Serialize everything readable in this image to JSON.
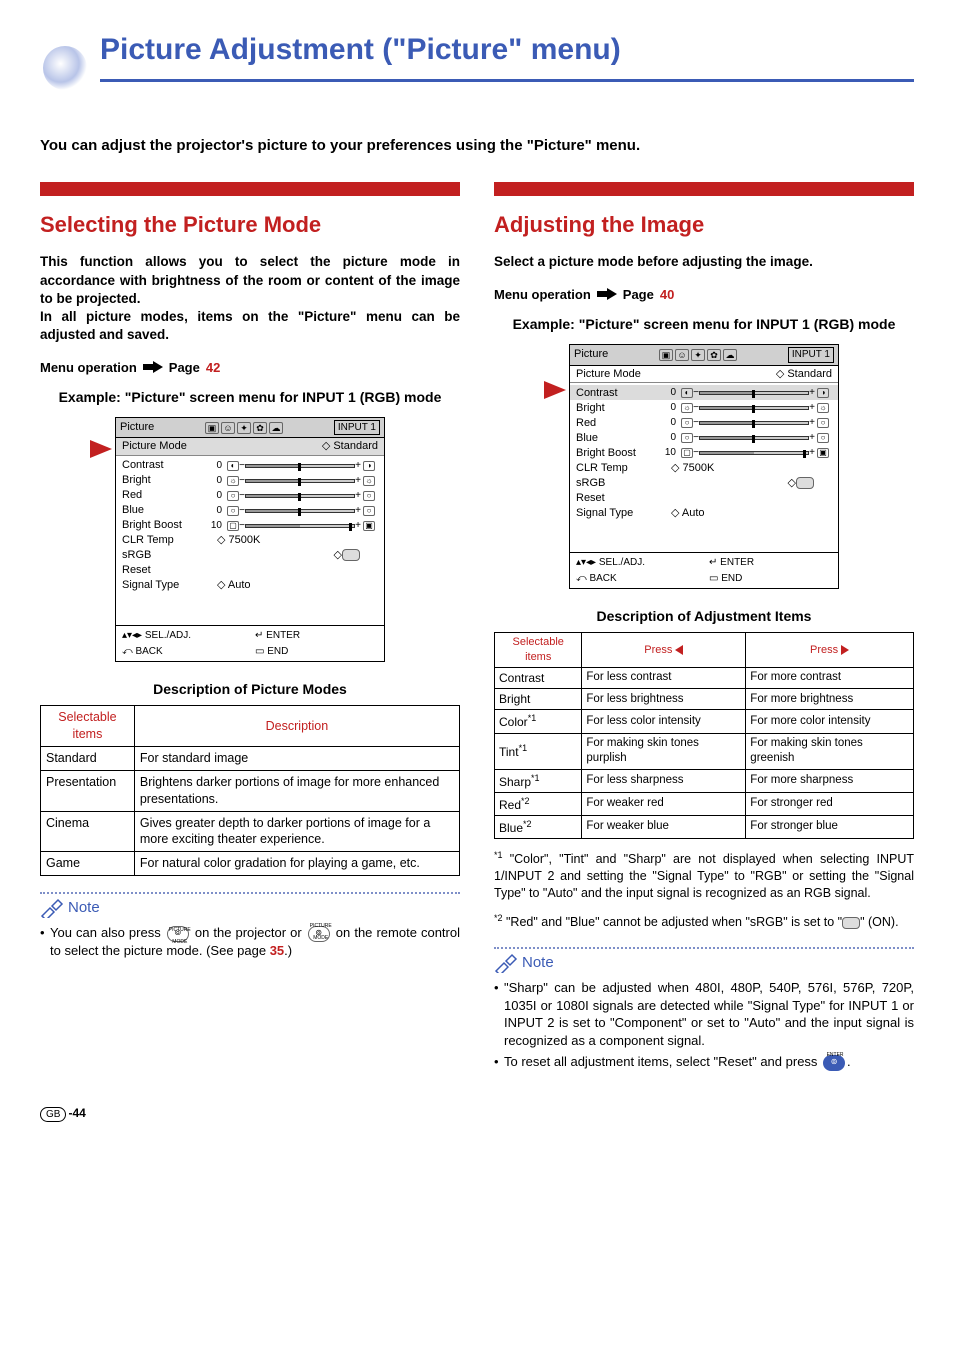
{
  "pageTitle": "Picture Adjustment (\"Picture\" menu)",
  "intro": "You can adjust the projector's picture to your preferences using the \"Picture\" menu.",
  "left": {
    "h2": "Selecting the Picture Mode",
    "body1": "This function allows you to select the picture mode in accordance with brightness of the room or content of the image to be projected.",
    "body2": "In all picture modes, items on the \"Picture\" menu can be adjusted and saved.",
    "menuOpLabel": "Menu operation",
    "menuOpPage": "Page",
    "menuOpNum": "42",
    "exampleTitle": "Example: \"Picture\" screen menu for INPUT 1 (RGB) mode",
    "arrowRow": 1,
    "tableTitle": "Description of Picture Modes",
    "tableHeaders": [
      "Selectable items",
      "Description"
    ],
    "tableRows": [
      [
        "Standard",
        "For standard image"
      ],
      [
        "Presentation",
        "Brightens darker portions of image for more enhanced presentations."
      ],
      [
        "Cinema",
        "Gives greater depth to darker portions of image for a more exciting theater experience."
      ],
      [
        "Game",
        "For natural color gradation for playing a game, etc."
      ]
    ],
    "noteLabel": "Note",
    "note1a": "You can also press ",
    "note1b": " on the projector or ",
    "note1c": " on the remote control to select the picture mode. (See page ",
    "note1page": "35",
    "note1d": ".)"
  },
  "right": {
    "h2": "Adjusting the Image",
    "body1": "Select a picture mode before adjusting the image.",
    "menuOpLabel": "Menu operation",
    "menuOpPage": "Page",
    "menuOpNum": "40",
    "exampleTitle": "Example: \"Picture\" screen menu for INPUT 1 (RGB) mode",
    "arrowRow": 2,
    "tableTitle": "Description of Adjustment Items",
    "tableHeaders": [
      "Selectable items",
      "Press",
      "Press"
    ],
    "tableRows": [
      [
        "Contrast",
        "For less contrast",
        "For more contrast"
      ],
      [
        "Bright",
        "For less brightness",
        "For more brightness"
      ],
      [
        "Color*1",
        "For less color intensity",
        "For more color intensity"
      ],
      [
        "Tint*1",
        "For making skin tones purplish",
        "For making skin tones greenish"
      ],
      [
        "Sharp*1",
        "For less sharpness",
        "For more sharpness"
      ],
      [
        "Red*2",
        "For weaker red",
        "For stronger red"
      ],
      [
        "Blue*2",
        "For weaker blue",
        "For stronger blue"
      ]
    ],
    "fn1": "\"Color\", \"Tint\" and \"Sharp\" are not displayed when selecting INPUT 1/INPUT 2 and setting the \"Signal Type\" to \"RGB\" or setting the \"Signal Type\" to \"Auto\" and the input signal is recognized as an RGB signal.",
    "fn2a": "\"Red\" and \"Blue\" cannot be adjusted when \"sRGB\" is set to \"",
    "fn2b": "\" (ON).",
    "noteLabel": "Note",
    "noteItems": [
      "\"Sharp\" can be adjusted when 480I, 480P, 540P, 576I, 576P, 720P, 1035I or 1080I signals are detected while \"Signal Type\" for INPUT 1 or INPUT 2 is set to \"Component\" or set to \"Auto\" and the input signal is recognized as a component signal.",
      "To reset all adjustment items, select \"Reset\" and press "
    ],
    "noteItem2end": "."
  },
  "osd": {
    "tabLabel": "Picture",
    "inputLabel": "INPUT 1",
    "pictureModeLabel": "Picture Mode",
    "pictureModeValue": "Standard",
    "sliders": [
      {
        "label": "Contrast",
        "val": "0"
      },
      {
        "label": "Bright",
        "val": "0"
      },
      {
        "label": "Red",
        "val": "0"
      },
      {
        "label": "Blue",
        "val": "0"
      },
      {
        "label": "Bright Boost",
        "val": "10"
      }
    ],
    "clrTempLabel": "CLR Temp",
    "clrTempVal": "7500K",
    "sRGBLabel": "sRGB",
    "resetLabel": "Reset",
    "signalTypeLabel": "Signal Type",
    "signalTypeVal": "Auto",
    "footer": {
      "seladj": "SEL./ADJ.",
      "enter": "ENTER",
      "back": "BACK",
      "end": "END"
    }
  },
  "pageFooter": {
    "gb": "GB",
    "num": "-44"
  }
}
